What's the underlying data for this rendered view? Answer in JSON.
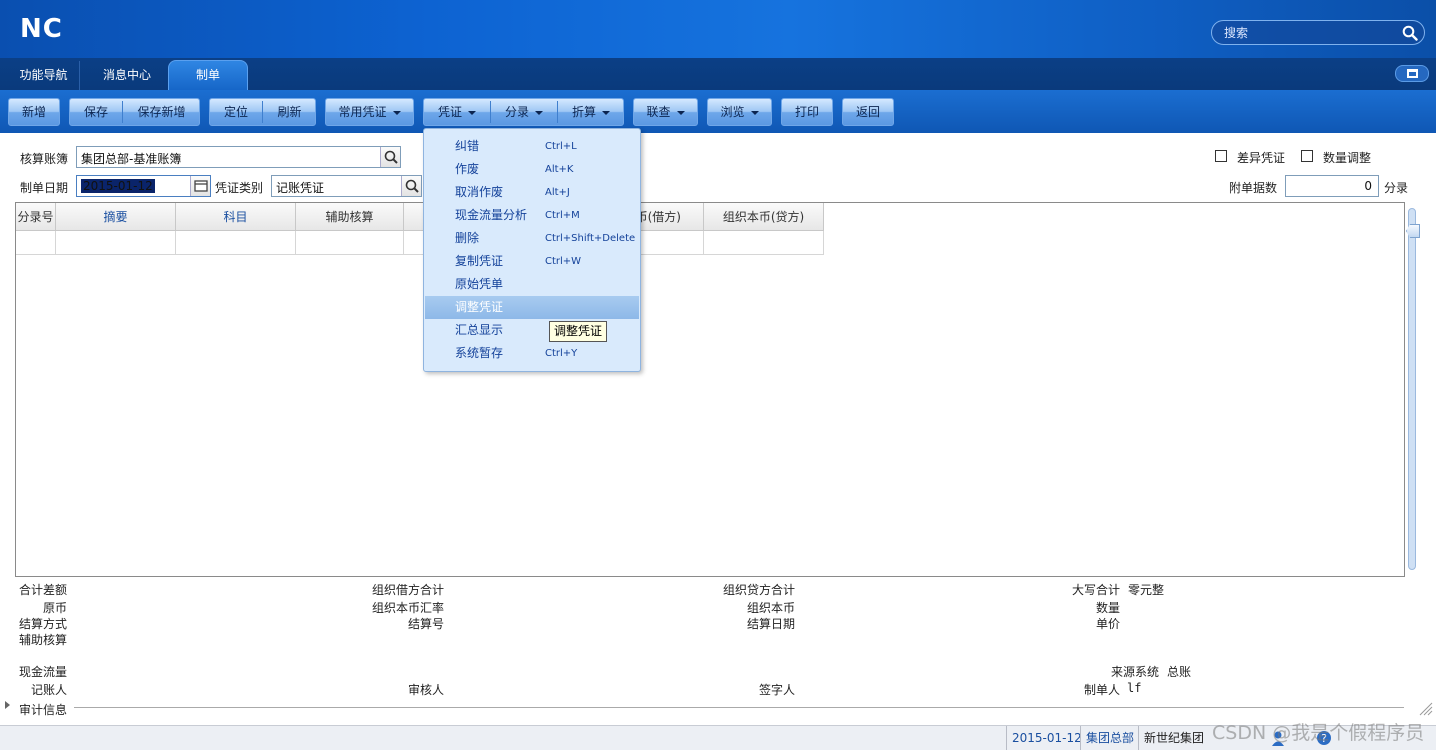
{
  "app": {
    "logo": "NC",
    "search_placeholder": "搜索"
  },
  "tabs": [
    {
      "label": "功能导航",
      "active": false
    },
    {
      "label": "消息中心",
      "active": false
    },
    {
      "label": "制单",
      "active": true
    }
  ],
  "toolbar": {
    "add": "新增",
    "save": "保存",
    "save_add": "保存新增",
    "locate": "定位",
    "refresh": "刷新",
    "common_voucher": "常用凭证",
    "voucher": "凭证",
    "entry": "分录",
    "convert": "折算",
    "query": "联查",
    "browse": "浏览",
    "print": "打印",
    "back": "返回"
  },
  "form": {
    "book_label": "核算账簿",
    "book_value": "集团总部-基准账簿",
    "date_label": "制单日期",
    "date_value": "2015-01-12",
    "type_label": "凭证类别",
    "type_value": "记账凭证",
    "diff_voucher_label": "差异凭证",
    "qty_adjust_label": "数量调整",
    "attach_label": "附单据数",
    "attach_value": "0",
    "attach_unit": "分录"
  },
  "grid": {
    "columns": [
      "分录号",
      "摘要",
      "科目",
      "辅助核算",
      "币(借方)",
      "组织本币(贷方)"
    ]
  },
  "summary": {
    "total_diff": "合计差额",
    "org_debit_total": "组织借方合计",
    "org_credit_total": "组织贷方合计",
    "uppercase_total": "大写合计",
    "uppercase_value": "零元整",
    "orig_currency": "原币",
    "org_rate": "组织本币汇率",
    "org_currency": "组织本币",
    "quantity": "数量",
    "settle_method": "结算方式",
    "settle_no": "结算号",
    "settle_date": "结算日期",
    "unit_price": "单价",
    "aux_accounting": "辅助核算",
    "cash_flow": "现金流量",
    "source_system": "来源系统",
    "source_value": "总账",
    "bookkeeper": "记账人",
    "auditor": "审核人",
    "signer": "签字人",
    "maker": "制单人",
    "maker_value": "lf",
    "audit_info": "审计信息"
  },
  "status_bar": {
    "date": "2015-01-12",
    "org": "集团总部",
    "group": "新世纪集团",
    "watermark": "CSDN @我是个假程序员"
  },
  "voucher_menu": {
    "items": [
      {
        "label": "纠错",
        "shortcut": "Ctrl+L"
      },
      {
        "label": "作废",
        "shortcut": "Alt+K"
      },
      {
        "label": "取消作废",
        "shortcut": "Alt+J"
      },
      {
        "label": "现金流量分析",
        "shortcut": "Ctrl+M"
      },
      {
        "label": "删除",
        "shortcut": "Ctrl+Shift+Delete"
      },
      {
        "label": "复制凭证",
        "shortcut": "Ctrl+W"
      },
      {
        "label": "原始凭单",
        "shortcut": ""
      },
      {
        "label": "调整凭证",
        "shortcut": "",
        "highlighted": true
      },
      {
        "label": "汇总显示",
        "shortcut": ""
      },
      {
        "label": "系统暂存",
        "shortcut": "Ctrl+Y"
      }
    ],
    "tooltip": "调整凭证"
  }
}
